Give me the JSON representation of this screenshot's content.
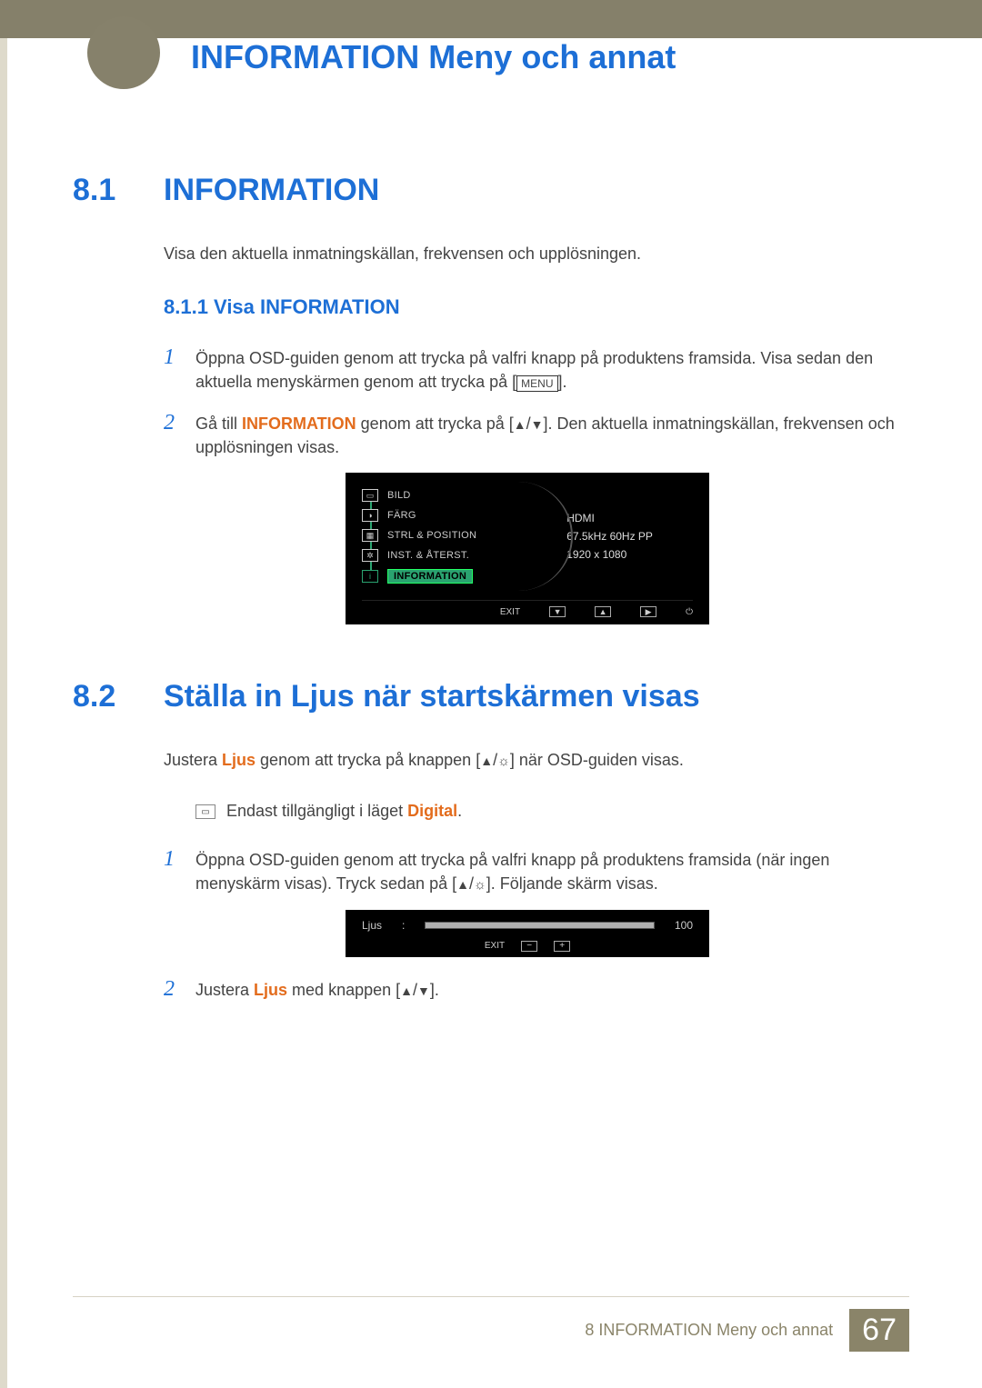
{
  "page": {
    "title": "INFORMATION Meny och annat",
    "footer_chapter": "8 INFORMATION Meny och annat",
    "footer_page": "67"
  },
  "s81": {
    "num": "8.1",
    "title": "INFORMATION",
    "intro": "Visa den aktuella inmatningskällan, frekvensen och upplösningen.",
    "sub_num_title": "8.1.1   Visa INFORMATION",
    "step1_a": "Öppna OSD-guiden genom att trycka på valfri knapp på produktens framsida. Visa sedan den aktuella menyskärmen genom att trycka på [",
    "menu_label": "MENU",
    "step1_b": "].",
    "step2_a": "Gå till ",
    "step2_hl": "INFORMATION",
    "step2_b": " genom att trycka på [",
    "step2_c": "]. Den aktuella inmatningskällan, frekvensen och upplösningen visas."
  },
  "osd1": {
    "items": {
      "bild": "BILD",
      "farg": "FÄRG",
      "strl": "STRL & POSITION",
      "inst": "INST. & ÅTERST.",
      "info": "INFORMATION"
    },
    "info_source": "HDMI",
    "info_freq": "67.5kHz 60Hz PP",
    "info_res": "1920 x 1080",
    "exit": "EXIT"
  },
  "s82": {
    "num": "8.2",
    "title": "Ställa in Ljus när startskärmen visas",
    "intro_a": "Justera ",
    "intro_hl": "Ljus",
    "intro_b": " genom att trycka på knappen [",
    "intro_c": "] när OSD-guiden visas.",
    "note_a": "Endast tillgängligt i läget ",
    "note_hl": "Digital",
    "note_b": ".",
    "step1_a": "Öppna OSD-guiden genom att trycka på valfri knapp på produktens framsida (när ingen menyskärm visas). Tryck sedan på [",
    "step1_b": "]. Följande skärm visas.",
    "step2_a": "Justera ",
    "step2_hl": "Ljus",
    "step2_b": " med knappen [",
    "step2_c": "]."
  },
  "osd2": {
    "label": "Ljus",
    "value": "100",
    "exit": "EXIT"
  }
}
